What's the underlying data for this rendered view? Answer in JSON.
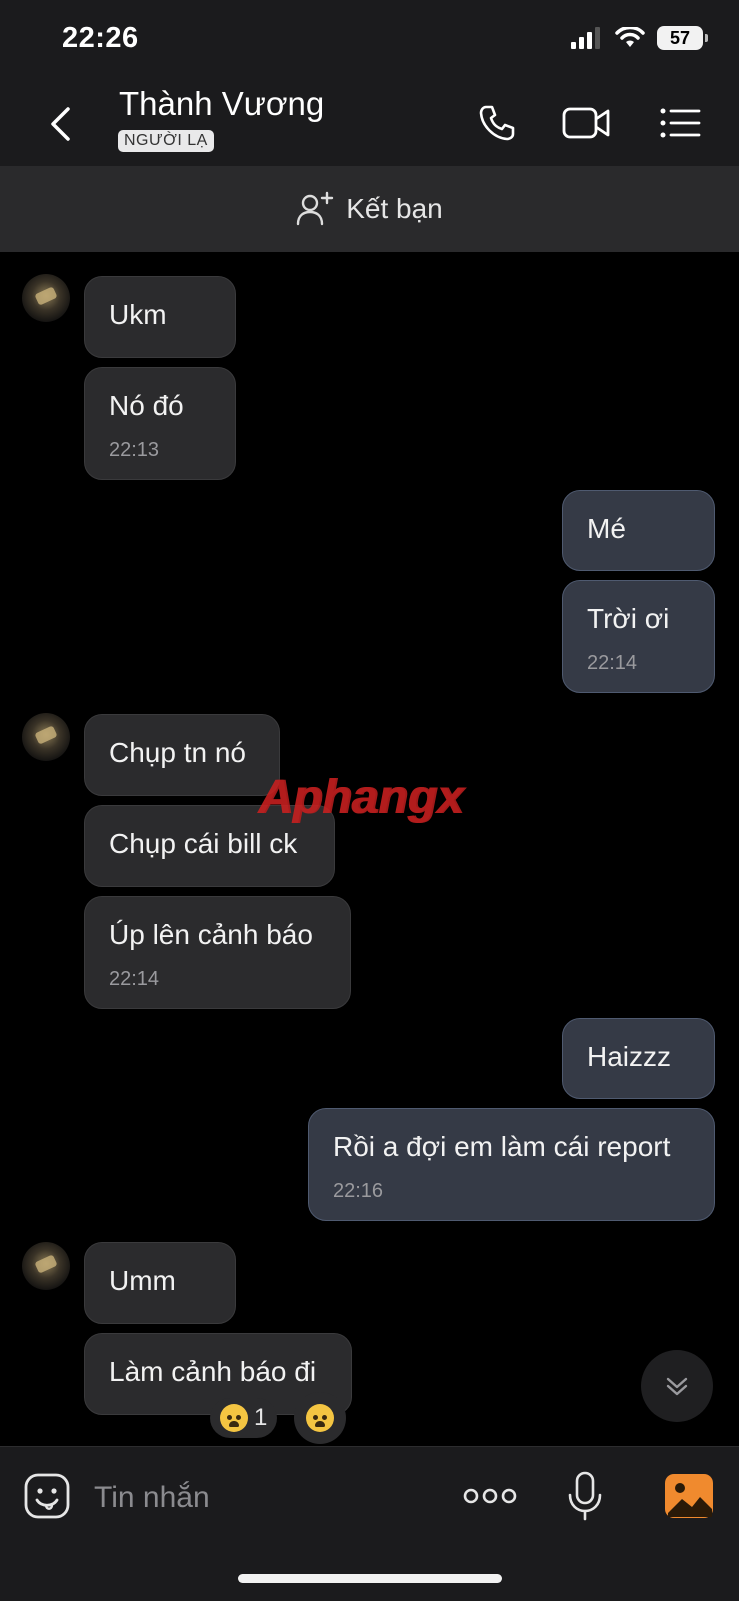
{
  "status_bar": {
    "time": "22:26",
    "battery": "57",
    "icons": [
      "signal-icon",
      "wifi-icon",
      "battery-icon"
    ]
  },
  "header": {
    "contact_name": "Thành Vương",
    "badge": "NGƯỜI LẠ",
    "icons": [
      "back-icon",
      "phone-icon",
      "video-icon",
      "menu-icon"
    ]
  },
  "friend_bar": {
    "label": "Kết bạn",
    "icon": "add-friend-icon"
  },
  "messages": [
    {
      "side": "in",
      "text": "Ukm"
    },
    {
      "side": "in",
      "text": "Nó đó",
      "time": "22:13"
    },
    {
      "side": "out",
      "text": "Mé"
    },
    {
      "side": "out",
      "text": "Trời ơi",
      "time": "22:14"
    },
    {
      "side": "in",
      "text": "Chụp tn nó"
    },
    {
      "side": "in",
      "text": "Chụp cái bill ck"
    },
    {
      "side": "in",
      "text": "Úp lên cảnh báo",
      "time": "22:14"
    },
    {
      "side": "out",
      "text": "Haizzz"
    },
    {
      "side": "out",
      "text": "Rồi a đợi em làm cái report",
      "time": "22:16"
    },
    {
      "side": "in",
      "text": "Umm"
    },
    {
      "side": "in",
      "text": "Làm cảnh báo đi"
    }
  ],
  "reaction": {
    "count": "1",
    "emoji": "crying-face-emoji"
  },
  "watermark": {
    "text_a": "Aphang",
    "text_b": "x"
  },
  "composer": {
    "placeholder": "Tin nhắn",
    "icons": [
      "sticker-icon",
      "more-icon",
      "microphone-icon",
      "photo-icon"
    ]
  },
  "colors": {
    "background": "#000000",
    "incoming_bubble": "#2b2b2d",
    "outgoing_bubble": "#353a46",
    "header": "#1b1b1d"
  }
}
